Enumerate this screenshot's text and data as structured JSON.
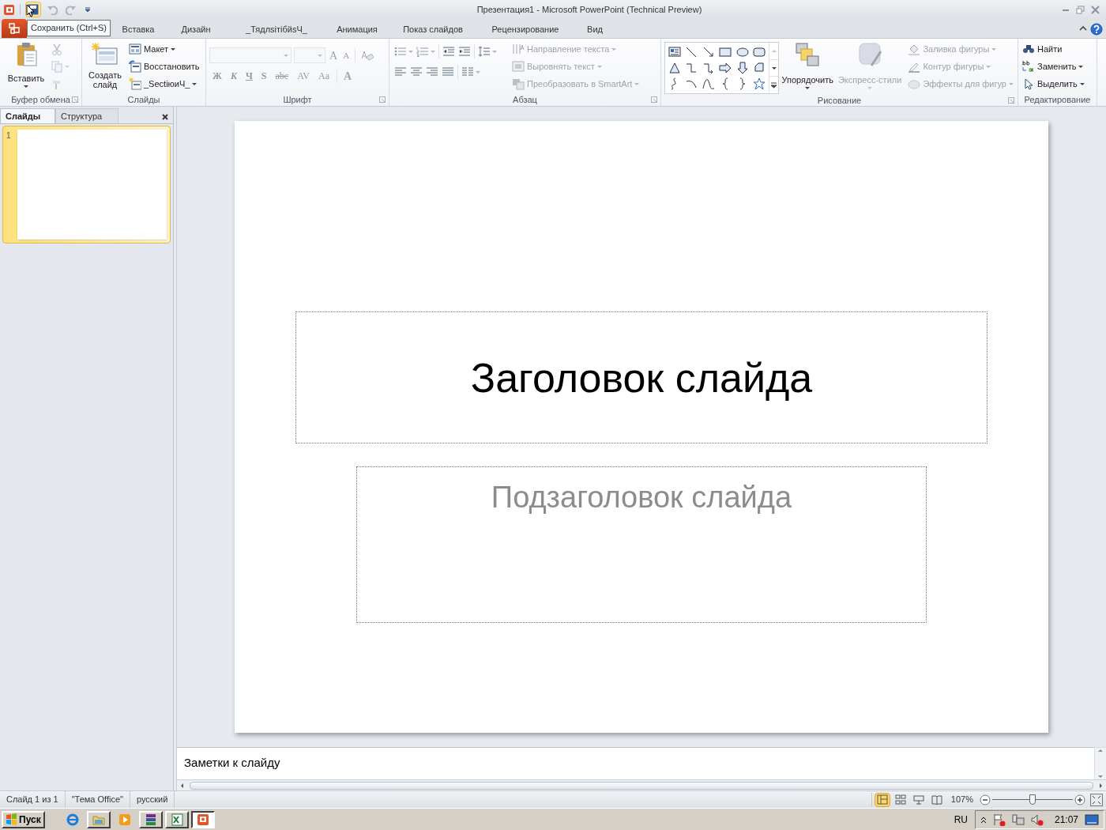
{
  "title_bar": {
    "title": "Презентация1 -  Microsoft PowerPoint (Technical Preview)",
    "quick_access": [
      {
        "kind": "save",
        "disabled": false,
        "hovered": true
      },
      {
        "kind": "undo",
        "disabled": true,
        "hovered": false
      },
      {
        "kind": "redo",
        "disabled": true,
        "hovered": false
      },
      {
        "kind": "customize",
        "disabled": false,
        "hovered": false
      }
    ]
  },
  "tooltip": {
    "text": "Сохранить (Ctrl+S)"
  },
  "tabs": [
    {
      "label": "Вставка",
      "selected": false
    },
    {
      "label": "Дизайн",
      "selected": false
    },
    {
      "label": "_ТядлsітiбйsЧ_",
      "selected": false
    },
    {
      "label": "Анимация",
      "selected": false
    },
    {
      "label": "Показ слайдов",
      "selected": false
    },
    {
      "label": "Рецензирование",
      "selected": false
    },
    {
      "label": "Вид",
      "selected": false
    }
  ],
  "ribbon": {
    "clipboard": {
      "label": "Буфер обмена",
      "paste": {
        "label": "Вставить",
        "disabled": false
      },
      "tools": [
        {
          "kind": "cut",
          "disabled": true
        },
        {
          "kind": "copy",
          "disabled": true
        },
        {
          "kind": "painter",
          "disabled": true
        }
      ]
    },
    "slides": {
      "label": "Слайды",
      "new_slide": {
        "label": "Создать слайд",
        "disabled": false
      },
      "items": [
        {
          "kind": "layout",
          "label": "Макет",
          "dropdown": true
        },
        {
          "kind": "reset",
          "label": "Восстановить",
          "dropdown": false
        },
        {
          "kind": "section",
          "label": "_SectіюиЧ_",
          "dropdown": true
        }
      ]
    },
    "font": {
      "label": "Шрифт",
      "font_box": {
        "disabled": true
      },
      "size_box": {
        "disabled": true
      },
      "grow_glyphs": [
        "A",
        "A"
      ],
      "format_glyphs": [
        "Ж",
        "К",
        "Ч",
        "S",
        "abc",
        "AV",
        "Aa"
      ],
      "color_glyph": "A"
    },
    "paragraph": {
      "label": "Абзац",
      "commands": [
        {
          "kind": "textdir",
          "label": "Направление текста",
          "disabled": true
        },
        {
          "kind": "aligntext",
          "label": "Выровнять текст",
          "disabled": true
        },
        {
          "kind": "smartart",
          "label": "Преобразовать в SmartArt",
          "disabled": true
        }
      ]
    },
    "drawing": {
      "label": "Рисование",
      "large": [
        {
          "kind": "arrange",
          "label": "Упорядочить",
          "disabled": false
        },
        {
          "kind": "quickstyles",
          "label": "Экспресс-стили",
          "disabled": true
        }
      ],
      "commands": [
        {
          "kind": "fill",
          "label": "Заливка фигуры",
          "disabled": true
        },
        {
          "kind": "outline",
          "label": "Контур фигуры",
          "disabled": true
        },
        {
          "kind": "effects",
          "label": "Эффекты для фигур",
          "disabled": true
        }
      ]
    },
    "editing": {
      "label": "Редактирование",
      "commands": [
        {
          "kind": "find",
          "label": "Найти",
          "dropdown": false
        },
        {
          "kind": "replace",
          "label": "Заменить",
          "dropdown": true
        },
        {
          "kind": "select",
          "label": "Выделить",
          "dropdown": true
        }
      ]
    }
  },
  "slides_pane": {
    "tabs": [
      {
        "label": "Слайды",
        "selected": true
      },
      {
        "label": "Структура",
        "selected": false
      }
    ],
    "thumbnails": [
      {
        "number": "1",
        "selected": true
      }
    ]
  },
  "slide": {
    "title": "Заголовок слайда",
    "subtitle": "Подзаголовок слайда"
  },
  "notes": {
    "placeholder": "Заметки к слайду"
  },
  "status_bar": {
    "items": [
      "Слайд 1 из 1",
      "\"Тема Office\"",
      "русский"
    ],
    "views": [
      {
        "kind": "normal",
        "selected": true
      },
      {
        "kind": "sorter",
        "selected": false
      },
      {
        "kind": "show",
        "selected": false
      },
      {
        "kind": "reading",
        "selected": false
      }
    ],
    "zoom": {
      "text": "107%",
      "level": 0.5
    }
  },
  "taskbar": {
    "start": "Пуск",
    "apps": [
      {
        "kind": "browser",
        "active": false
      },
      {
        "kind": "folder",
        "active": false
      },
      {
        "kind": "media",
        "active": false
      },
      {
        "kind": "archive",
        "active": false
      },
      {
        "kind": "sheet",
        "active": false
      },
      {
        "kind": "slides",
        "active": true
      }
    ],
    "language": "RU",
    "clock": "21:07"
  }
}
